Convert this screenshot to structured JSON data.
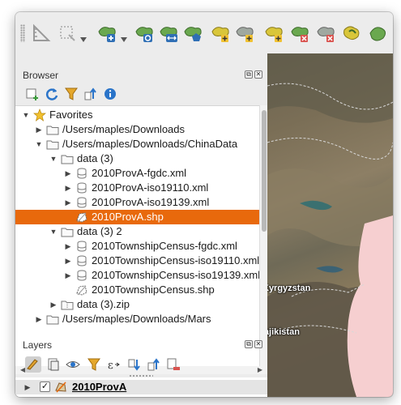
{
  "browser": {
    "title": "Browser",
    "tree": [
      {
        "label": "Favorites",
        "icon": "star-icon",
        "expanded": true,
        "level": 0
      },
      {
        "label": "/Users/maples/Downloads",
        "icon": "folder-icon",
        "expanded": false,
        "level": 1
      },
      {
        "label": "/Users/maples/Downloads/ChinaData",
        "icon": "folder-icon",
        "expanded": true,
        "level": 1
      },
      {
        "label": "data (3)",
        "icon": "folder-icon",
        "expanded": true,
        "level": 2
      },
      {
        "label": "2010ProvA-fgdc.xml",
        "icon": "database-icon",
        "expanded": false,
        "level": 3
      },
      {
        "label": "2010ProvA-iso19110.xml",
        "icon": "database-icon",
        "expanded": false,
        "level": 3
      },
      {
        "label": "2010ProvA-iso19139.xml",
        "icon": "database-icon",
        "expanded": false,
        "level": 3
      },
      {
        "label": "2010ProvA.shp",
        "icon": "polygon-layer-icon",
        "expanded": false,
        "level": 3,
        "selected": true
      },
      {
        "label": "data (3) 2",
        "icon": "folder-icon",
        "expanded": true,
        "level": 2
      },
      {
        "label": "2010TownshipCensus-fgdc.xml",
        "icon": "database-icon",
        "expanded": false,
        "level": 3
      },
      {
        "label": "2010TownshipCensus-iso19110.xml",
        "icon": "database-icon",
        "expanded": false,
        "level": 3
      },
      {
        "label": "2010TownshipCensus-iso19139.xml",
        "icon": "database-icon",
        "expanded": false,
        "level": 3
      },
      {
        "label": "2010TownshipCensus.shp",
        "icon": "polygon-layer-icon",
        "expanded": false,
        "level": 3
      },
      {
        "label": "data (3).zip",
        "icon": "archive-icon",
        "expanded": false,
        "level": 2
      },
      {
        "label": "/Users/maples/Downloads/Mars",
        "icon": "folder-icon",
        "expanded": false,
        "level": 1
      }
    ]
  },
  "layers": {
    "title": "Layers",
    "items": [
      {
        "label": "2010ProvA",
        "checked": true
      }
    ]
  },
  "map": {
    "labels": [
      "Kyrgyzstan",
      "Tajikistan"
    ]
  },
  "colors": {
    "selection": "#e8690c",
    "map_pink": "#f6cfd0"
  }
}
